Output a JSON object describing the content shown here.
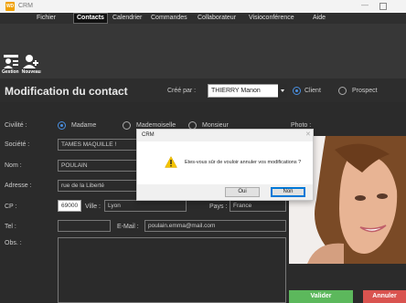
{
  "window": {
    "title": "CRM",
    "logo_text": "WD"
  },
  "menu": [
    {
      "label": "Fichier",
      "active": false
    },
    {
      "label": "Contacts",
      "active": true
    },
    {
      "label": "Calendrier",
      "active": false
    },
    {
      "label": "Commandes",
      "active": false
    },
    {
      "label": "Collaborateur",
      "active": false
    },
    {
      "label": "Visioconférence",
      "active": false
    },
    {
      "label": "Aide",
      "active": false
    }
  ],
  "toolbar": {
    "labels": [
      "Gestion",
      "Nouveau"
    ],
    "icons": [
      "contacts-list-icon",
      "add-contact-icon"
    ]
  },
  "header": {
    "title": "Modification du contact",
    "created_by_label": "Créé par :",
    "created_by_value": "THIERRY Manon",
    "type_options": [
      {
        "label": "Client",
        "selected": true
      },
      {
        "label": "Prospect",
        "selected": false
      }
    ]
  },
  "form": {
    "civilite_label": "Civilité :",
    "civilite_options": [
      {
        "label": "Madame",
        "selected": true
      },
      {
        "label": "Mademoiselle",
        "selected": false
      },
      {
        "label": "Monsieur",
        "selected": false
      }
    ],
    "photo_label": "Photo :",
    "societe_label": "Société :",
    "societe_value": "TAMES MAQUILLE !",
    "nom_label": "Nom :",
    "nom_value": "POULAIN",
    "adresse_label": "Adresse :",
    "adresse_value": "rue de la Liberté",
    "cp_label": "CP :",
    "cp_value": "69000",
    "ville_label": "Ville :",
    "ville_value": "Lyon",
    "pays_label": "Pays :",
    "pays_value": "France",
    "tel_label": "Tel :",
    "tel_value": "",
    "email_label": "E-Mail :",
    "email_value": "poulain.emma@mail.com",
    "obs_label": "Obs. :"
  },
  "buttons": {
    "valider": "Valider",
    "annuler": "Annuler"
  },
  "dialog": {
    "title": "CRM",
    "message": "Etes-vous sûr de vouloir annuler vos modifications ?",
    "yes": "Oui",
    "no": "Non"
  },
  "colors": {
    "accent": "#4a90e2",
    "valider": "#5cb85c",
    "annuler": "#d9534f",
    "dark_bg": "#2b2b2b"
  }
}
